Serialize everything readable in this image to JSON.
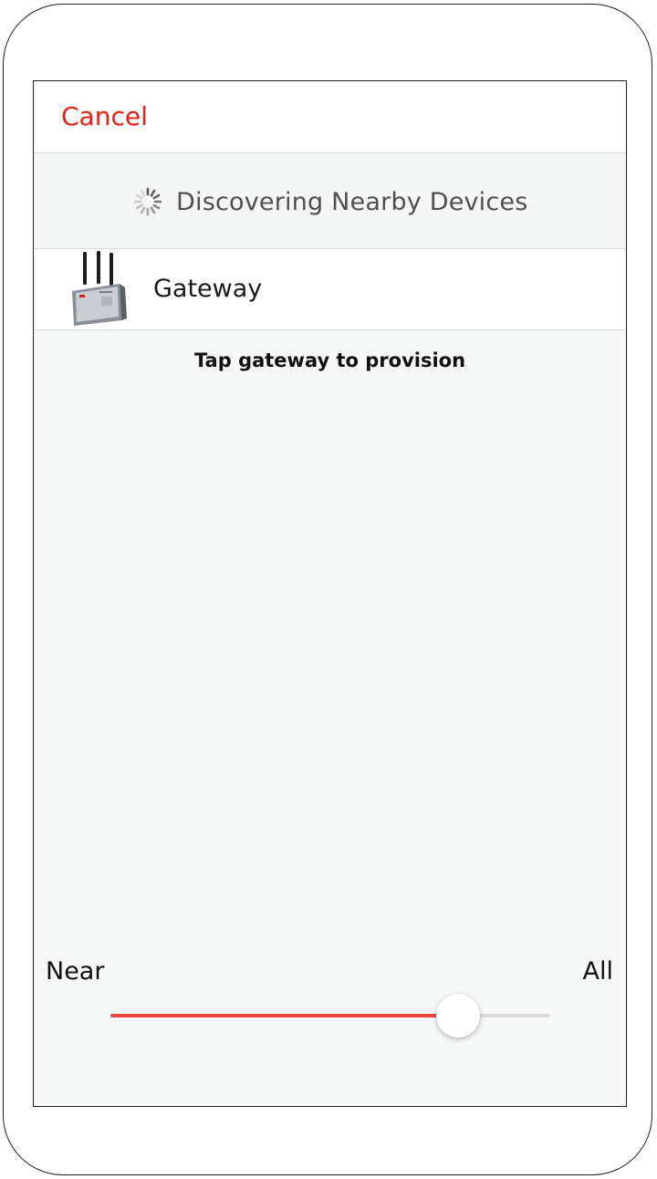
{
  "nav": {
    "cancel_label": "Cancel"
  },
  "discovery": {
    "status_text": "Discovering Nearby Devices",
    "spinner_icon": "activity-spinner-icon"
  },
  "devices": [
    {
      "name": "Gateway",
      "icon": "gateway-router-icon"
    }
  ],
  "hint": "Tap gateway to provision",
  "range_slider": {
    "min_label": "Near",
    "max_label": "All",
    "value_fraction": 0.79
  },
  "colors": {
    "accent": "#e2231a",
    "slider_fill": "#e8483d",
    "background": "#f6f8f8"
  }
}
